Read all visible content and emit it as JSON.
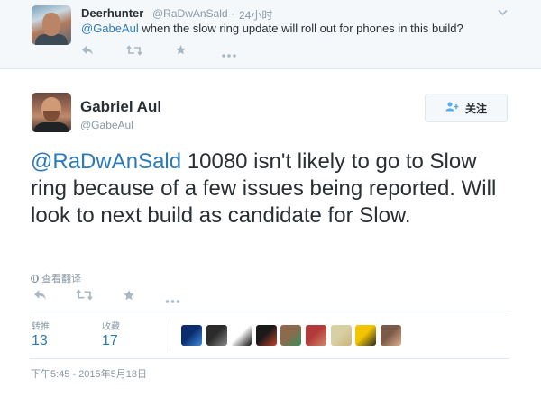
{
  "parent_tweet": {
    "name": "Deerhunter",
    "handle": "@RaDwAnSald",
    "time": "24小时",
    "mention": "@GabeAul",
    "text_rest": " when the slow ring update will roll out for phones in this build?",
    "chevron_icon": "chevron-down-icon"
  },
  "main_tweet": {
    "name": "Gabriel Aul",
    "handle": "@GabeAul",
    "follow_label": "关注",
    "follow_icon": "follow-person-icon",
    "mention": "@RaDwAnSald",
    "text_rest": " 10080 isn't likely to go to Slow ring because of a few issues being reported. Will look to next build as candidate for Slow.",
    "translate_label": "查看翻译",
    "stats": {
      "retweets_label": "转推",
      "retweets": "13",
      "favorites_label": "收藏",
      "favorites": "17"
    },
    "timestamp": "下午5:45 - 2015年5月18日"
  },
  "action_icons": [
    "reply-icon",
    "retweet-icon",
    "favorite-icon",
    "more-icon"
  ],
  "favoriters": [
    {
      "name": "favoriter-1",
      "colors": [
        "#0b2c6e",
        "#3f8be0"
      ]
    },
    {
      "name": "favoriter-2",
      "colors": [
        "#2b2b2b",
        "#8a8a8a"
      ]
    },
    {
      "name": "favoriter-3",
      "colors": [
        "#ffffff",
        "#111111"
      ]
    },
    {
      "name": "favoriter-4",
      "colors": [
        "#1a1a1a",
        "#c2412b"
      ]
    },
    {
      "name": "favoriter-5",
      "colors": [
        "#8e6a4d",
        "#3a8f5a"
      ]
    },
    {
      "name": "favoriter-6",
      "colors": [
        "#b33a3a",
        "#d08a6a"
      ]
    },
    {
      "name": "favoriter-7",
      "colors": [
        "#d9cfa5",
        "#c9b47a"
      ]
    },
    {
      "name": "favoriter-8",
      "colors": [
        "#f2c500",
        "#2a2a2a"
      ]
    },
    {
      "name": "favoriter-9",
      "colors": [
        "#7a5a48",
        "#e3b08e"
      ]
    }
  ],
  "colors": {
    "link": "#2b7bb9",
    "muted": "#8899a6",
    "text": "#292f33",
    "icon_muted": "#aab8c2",
    "follow_icon": "#55acee"
  }
}
